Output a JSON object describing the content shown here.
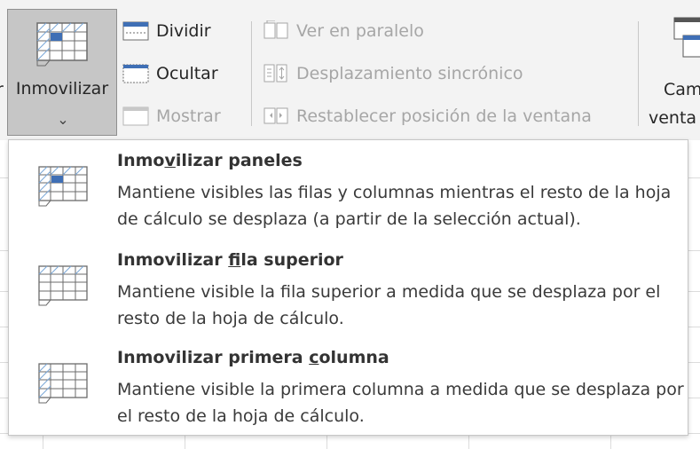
{
  "ribbon": {
    "left_cut_label": "r",
    "freeze_button": {
      "label": "Inmovilizar",
      "chevron": "⌄"
    },
    "split": {
      "label": "Dividir",
      "icon": "split-icon"
    },
    "hide": {
      "label": "Ocultar",
      "icon": "hide-window-icon"
    },
    "show": {
      "label": "Mostrar",
      "icon": "show-window-icon"
    },
    "side_by_side": {
      "label": "Ver en paralelo",
      "icon": "side-by-side-icon"
    },
    "sync_scroll": {
      "label": "Desplazamiento sincrónico",
      "icon": "sync-scroll-icon"
    },
    "reset_position": {
      "label": "Restablecer posición de la ventana",
      "icon": "reset-window-icon"
    },
    "switch_windows": {
      "label_line1": "Cam",
      "label_line2": "venta",
      "icon": "switch-windows-icon"
    }
  },
  "menu": {
    "items": [
      {
        "title_pre": "Inmo",
        "title_key": "v",
        "title_post": "ilizar paneles",
        "description": "Mantiene visibles las filas y columnas mientras el resto de la hoja de cálculo se desplaza (a partir de la selección actual).",
        "icon": "freeze-panes-icon"
      },
      {
        "title_pre": "Inmovilizar ",
        "title_key": "f",
        "title_post": "ila superior",
        "description": "Mantiene visible la fila superior a medida que se desplaza por el resto de la hoja de cálculo.",
        "icon": "freeze-top-row-icon"
      },
      {
        "title_pre": "Inmovilizar primera ",
        "title_key": "c",
        "title_post": "olumna",
        "description": "Mantiene visible la primera columna a medida que se desplaza por el resto de la hoja de cálculo.",
        "icon": "freeze-first-column-icon"
      }
    ]
  },
  "colors": {
    "ribbon_bg": "#f3f3f3",
    "pressed_bg": "#c6c6c6",
    "accent_blue": "#3f6fb5",
    "disabled_text": "#a6a6a6"
  }
}
